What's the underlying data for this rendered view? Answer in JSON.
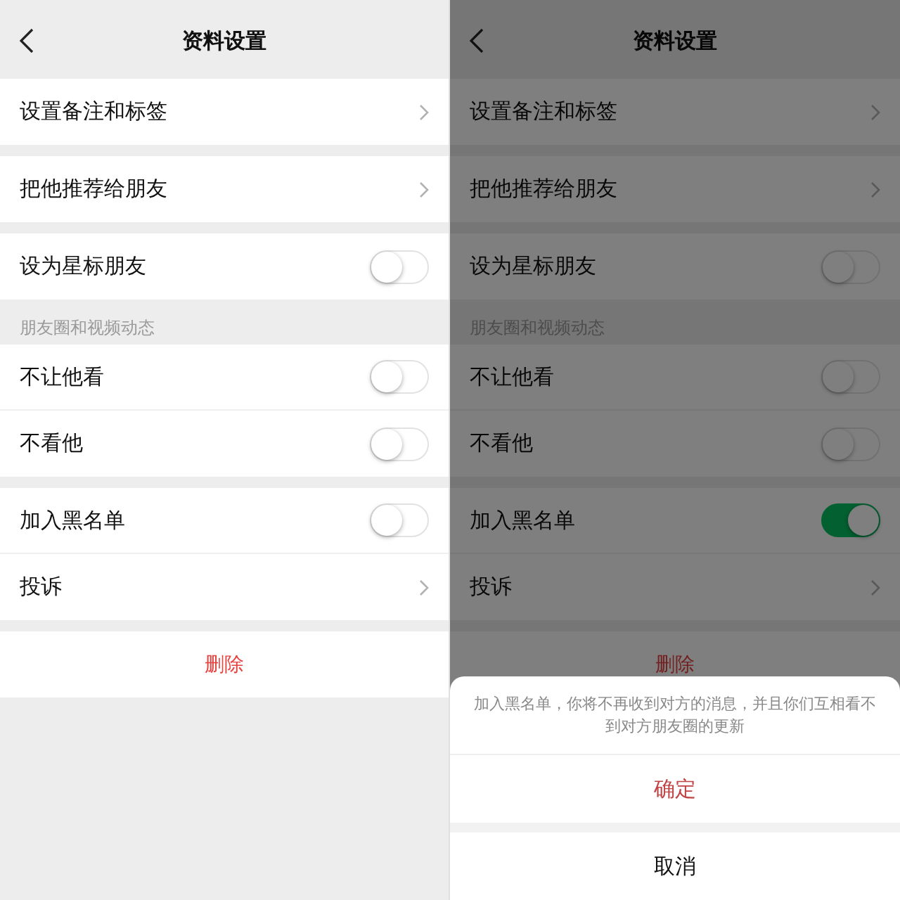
{
  "panels": [
    {
      "title": "资料设置",
      "groups": [
        {
          "rows": [
            {
              "label": "设置备注和标签",
              "kind": "link"
            }
          ]
        },
        {
          "rows": [
            {
              "label": "把他推荐给朋友",
              "kind": "link"
            }
          ]
        },
        {
          "rows": [
            {
              "label": "设为星标朋友",
              "kind": "toggle",
              "on": false
            }
          ]
        },
        {
          "header": "朋友圈和视频动态",
          "rows": [
            {
              "label": "不让他看",
              "kind": "toggle",
              "on": false
            },
            {
              "label": "不看他",
              "kind": "toggle",
              "on": false
            }
          ]
        },
        {
          "rows": [
            {
              "label": "加入黑名单",
              "kind": "toggle",
              "on": false
            },
            {
              "label": "投诉",
              "kind": "link"
            }
          ]
        }
      ],
      "delete": "删除"
    },
    {
      "title": "资料设置",
      "groups": [
        {
          "rows": [
            {
              "label": "设置备注和标签",
              "kind": "link"
            }
          ]
        },
        {
          "rows": [
            {
              "label": "把他推荐给朋友",
              "kind": "link"
            }
          ]
        },
        {
          "rows": [
            {
              "label": "设为星标朋友",
              "kind": "toggle",
              "on": false
            }
          ]
        },
        {
          "header": "朋友圈和视频动态",
          "rows": [
            {
              "label": "不让他看",
              "kind": "toggle",
              "on": false
            },
            {
              "label": "不看他",
              "kind": "toggle",
              "on": false
            }
          ]
        },
        {
          "rows": [
            {
              "label": "加入黑名单",
              "kind": "toggle",
              "on": true
            },
            {
              "label": "投诉",
              "kind": "link"
            }
          ]
        }
      ],
      "delete": "删除",
      "sheet": {
        "message": "加入黑名单，你将不再收到对方的消息，并且你们互相看不到对方朋友圈的更新",
        "confirm": "确定",
        "cancel": "取消"
      }
    }
  ]
}
